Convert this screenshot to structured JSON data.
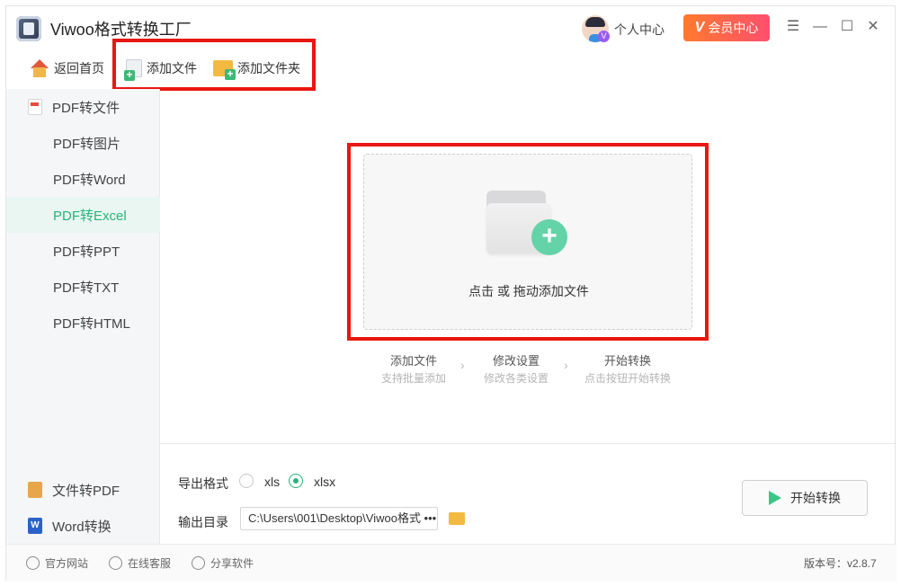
{
  "app": {
    "title": "Viwoo格式转换工厂"
  },
  "header": {
    "user_center": "个人中心",
    "vip_label": "会员中心",
    "vip_mark": "V",
    "avatar_badge": "V"
  },
  "toolbar": {
    "home": "返回首页",
    "add_file": "添加文件",
    "add_folder": "添加文件夹"
  },
  "sidebar": {
    "group_pdf": "PDF转文件",
    "items": [
      "PDF转图片",
      "PDF转Word",
      "PDF转Excel",
      "PDF转PPT",
      "PDF转TXT",
      "PDF转HTML"
    ],
    "active_index": 2,
    "group_file_to_pdf": "文件转PDF",
    "group_word": "Word转换",
    "word_icon_letter": "W"
  },
  "dropzone": {
    "text": "点击 或 拖动添加文件"
  },
  "steps": [
    {
      "title": "添加文件",
      "sub": "支持批量添加"
    },
    {
      "title": "修改设置",
      "sub": "修改各类设置"
    },
    {
      "title": "开始转换",
      "sub": "点击按钮开始转换"
    }
  ],
  "settings": {
    "format_label": "导出格式",
    "formats": [
      "xls",
      "xlsx"
    ],
    "selected_format": "xlsx",
    "output_label": "输出目录",
    "output_path": "C:\\Users\\001\\Desktop\\Viwoo格式 •••",
    "start_button": "开始转换"
  },
  "footer": {
    "website": "官方网站",
    "support": "在线客服",
    "share": "分享软件",
    "version": "版本号：v2.8.7"
  },
  "colors": {
    "accent": "#27b47d",
    "highlight_box": "#e8170f",
    "vip_gradient_start": "#ff7a2e",
    "vip_gradient_end": "#ff4f6d"
  }
}
